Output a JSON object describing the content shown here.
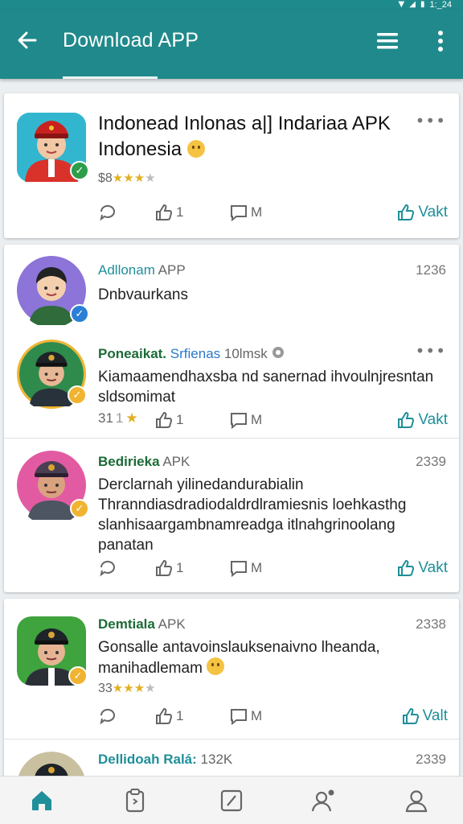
{
  "status": {
    "time": "1:_24"
  },
  "header": {
    "title": "Download APP"
  },
  "colors": {
    "header": "#20898b",
    "accent": "#1f8f99",
    "green_name": "#1b6b37",
    "star": "#e0b024"
  },
  "cards": [
    {
      "title": "Indonead Inlonas a|] Indariaa APK Indonesia",
      "rating_prefix": "$8",
      "rating_stars": 3,
      "actions": {
        "like_count": "1",
        "message_label": "M",
        "vote_label": "Vakt"
      }
    }
  ],
  "posts": [
    {
      "name": "Adllonam",
      "tag": "APP",
      "time": "1236",
      "text": "Dnbvaurkans"
    },
    {
      "name": "Poneaikat.",
      "link": "Srfienas",
      "meta": "10lmsk",
      "text": "Kiamaamendhaxsba nd sanernad ihvoulnjresntan sldsomimat",
      "rating_prefix": "31",
      "rating_number": "1",
      "actions": {
        "message_label": "M",
        "vote_label": "Vakt"
      }
    },
    {
      "name": "Bedirieka",
      "tag": "APK",
      "time": "2339",
      "text": "Derclarnah yilinedandurabialin Thranndiasdradiodaldrdlramiesnis loehkasthg slanhisaargambnamreadga itlnahgrinoolang panatan",
      "actions": {
        "like_count": "1",
        "message_label": "M",
        "vote_label": "Vakt"
      }
    },
    {
      "name": "Demtiala",
      "tag": "APK",
      "time": "2338",
      "text": "Gonsalle antavoinslauksenaivno lheanda, manihadlemam",
      "rating_prefix": "33",
      "rating_stars": 3,
      "actions": {
        "like_count": "1",
        "message_label": "M",
        "vote_label": "Valt"
      }
    },
    {
      "name": "Dellidoah Ralá:",
      "meta": "132K",
      "time": "2339"
    }
  ],
  "nav": [
    "home-icon",
    "clipboard-icon",
    "edit-icon",
    "profile-notification-icon",
    "account-icon"
  ]
}
